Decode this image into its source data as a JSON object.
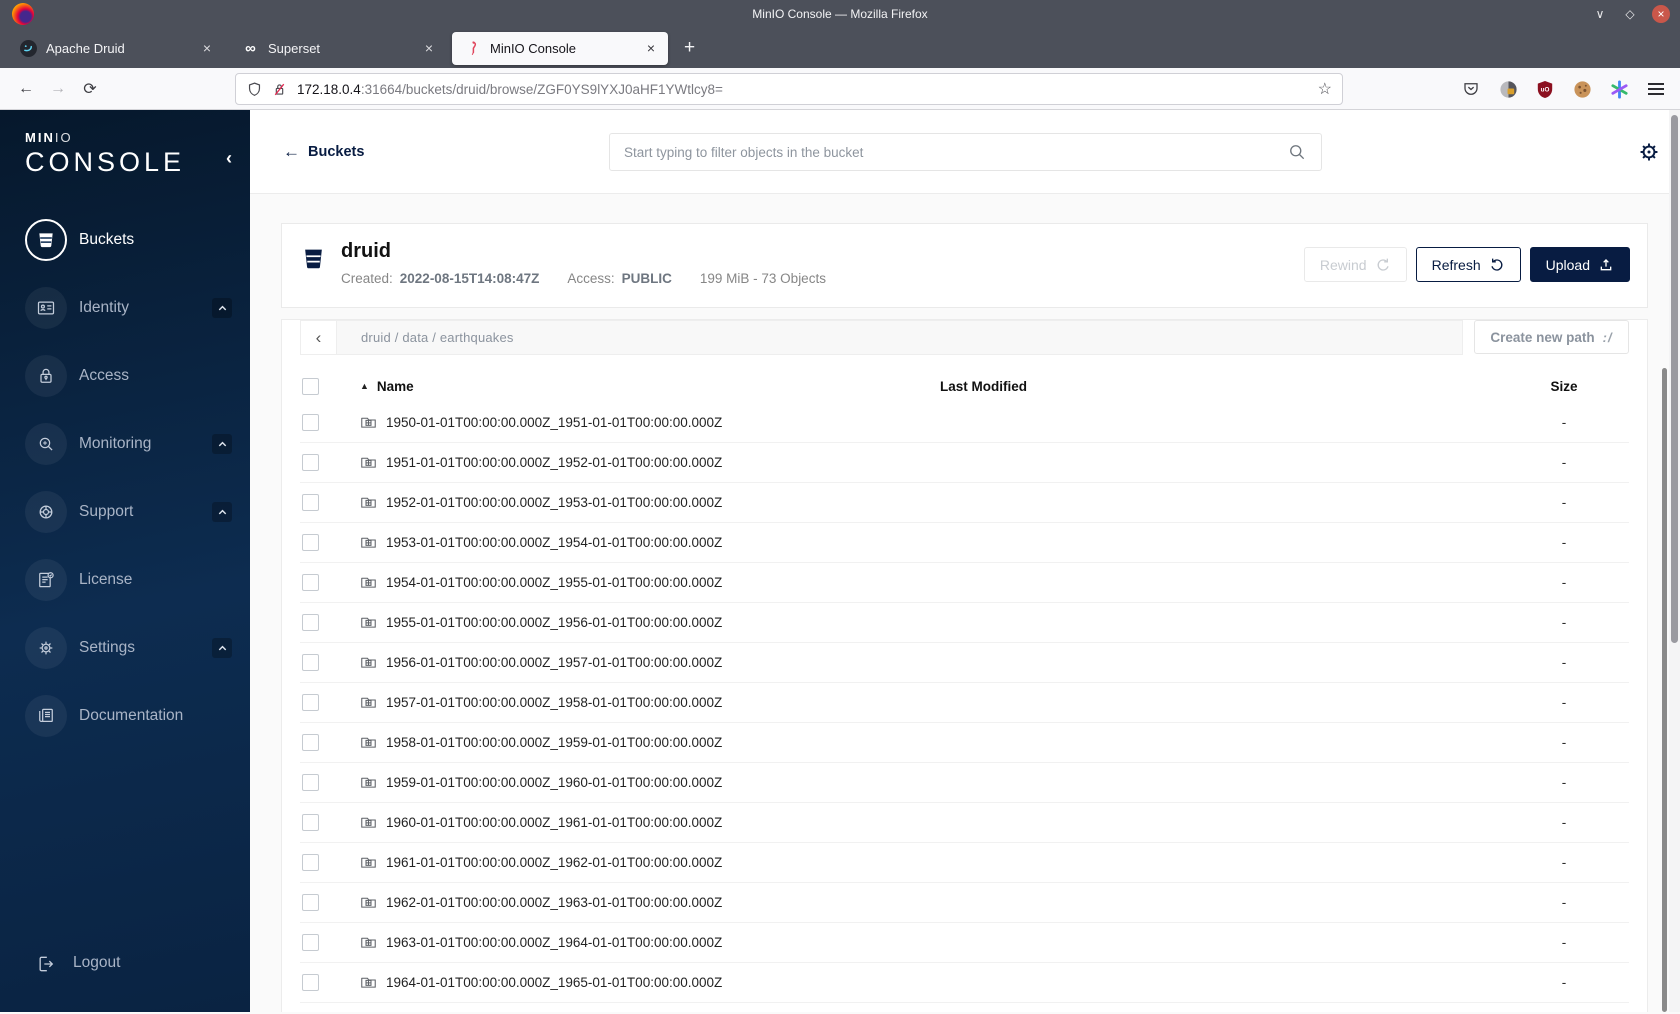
{
  "browser": {
    "window_title": "MinIO Console — Mozilla Firefox",
    "tabs": [
      {
        "title": "Apache Druid",
        "icon": "druid-favicon",
        "active": false
      },
      {
        "title": "Superset",
        "icon": "superset-favicon",
        "active": false
      },
      {
        "title": "MinIO Console",
        "icon": "minio-favicon",
        "active": true
      }
    ],
    "close_glyph": "×",
    "minimize_glyph": "∨",
    "maximize_glyph": "◇",
    "superset_glyph": "∞",
    "back_glyph": "←",
    "forward_glyph": "→",
    "reload_glyph": "⟳",
    "star_glyph": "☆",
    "url_host": "172.18.0.4",
    "url_rest": ":31664/buckets/druid/browse/ZGF0YS9lYXJ0aHF1YWtlcy8="
  },
  "theme": {
    "navy": "#081C42",
    "sidebar_gradient_top": "#06182c",
    "sidebar_gradient_bottom": "#0a2342",
    "page_background": "#fafafa"
  },
  "sidebar": {
    "logo_top_bold": "MIN",
    "logo_top_thin": "IO",
    "logo_main": "CONSOLE",
    "collapse_glyph": "‹",
    "items": [
      {
        "id": "buckets",
        "label": "Buckets",
        "icon": "bucket-icon",
        "active": true,
        "expandable": false
      },
      {
        "id": "identity",
        "label": "Identity",
        "icon": "identity-card-icon",
        "active": false,
        "expandable": true
      },
      {
        "id": "access",
        "label": "Access",
        "icon": "lock-user-icon",
        "active": false,
        "expandable": false
      },
      {
        "id": "monitoring",
        "label": "Monitoring",
        "icon": "monitor-search-icon",
        "active": false,
        "expandable": true
      },
      {
        "id": "support",
        "label": "Support",
        "icon": "lifebuoy-icon",
        "active": false,
        "expandable": true
      },
      {
        "id": "license",
        "label": "License",
        "icon": "license-doc-icon",
        "active": false,
        "expandable": false
      },
      {
        "id": "settings",
        "label": "Settings",
        "icon": "gear-icon",
        "active": false,
        "expandable": true
      },
      {
        "id": "documentation",
        "label": "Documentation",
        "icon": "book-icon",
        "active": false,
        "expandable": false
      }
    ],
    "logout_label": "Logout"
  },
  "header": {
    "back_label": "Buckets",
    "back_glyph": "←",
    "search_placeholder": "Start typing to filter objects in the bucket"
  },
  "bucket": {
    "name": "druid",
    "created_label": "Created:",
    "created_value": "2022-08-15T14:08:47Z",
    "access_label": "Access:",
    "access_value": "PUBLIC",
    "stats": "199 MiB - 73 Objects",
    "rewind_label": "Rewind",
    "refresh_label": "Refresh",
    "upload_label": "Upload"
  },
  "browse": {
    "back_glyph": "‹",
    "path": "druid / data / earthquakes",
    "create_path_label": "Create new path",
    "create_path_glyph": ":/"
  },
  "table": {
    "sort_glyph": "▲",
    "columns": {
      "name": "Name",
      "last_modified": "Last Modified",
      "size": "Size"
    },
    "rows": [
      {
        "name": "1950-01-01T00:00:00.000Z_1951-01-01T00:00:00.000Z",
        "last_modified": "",
        "size": "-"
      },
      {
        "name": "1951-01-01T00:00:00.000Z_1952-01-01T00:00:00.000Z",
        "last_modified": "",
        "size": "-"
      },
      {
        "name": "1952-01-01T00:00:00.000Z_1953-01-01T00:00:00.000Z",
        "last_modified": "",
        "size": "-"
      },
      {
        "name": "1953-01-01T00:00:00.000Z_1954-01-01T00:00:00.000Z",
        "last_modified": "",
        "size": "-"
      },
      {
        "name": "1954-01-01T00:00:00.000Z_1955-01-01T00:00:00.000Z",
        "last_modified": "",
        "size": "-"
      },
      {
        "name": "1955-01-01T00:00:00.000Z_1956-01-01T00:00:00.000Z",
        "last_modified": "",
        "size": "-"
      },
      {
        "name": "1956-01-01T00:00:00.000Z_1957-01-01T00:00:00.000Z",
        "last_modified": "",
        "size": "-"
      },
      {
        "name": "1957-01-01T00:00:00.000Z_1958-01-01T00:00:00.000Z",
        "last_modified": "",
        "size": "-"
      },
      {
        "name": "1958-01-01T00:00:00.000Z_1959-01-01T00:00:00.000Z",
        "last_modified": "",
        "size": "-"
      },
      {
        "name": "1959-01-01T00:00:00.000Z_1960-01-01T00:00:00.000Z",
        "last_modified": "",
        "size": "-"
      },
      {
        "name": "1960-01-01T00:00:00.000Z_1961-01-01T00:00:00.000Z",
        "last_modified": "",
        "size": "-"
      },
      {
        "name": "1961-01-01T00:00:00.000Z_1962-01-01T00:00:00.000Z",
        "last_modified": "",
        "size": "-"
      },
      {
        "name": "1962-01-01T00:00:00.000Z_1963-01-01T00:00:00.000Z",
        "last_modified": "",
        "size": "-"
      },
      {
        "name": "1963-01-01T00:00:00.000Z_1964-01-01T00:00:00.000Z",
        "last_modified": "",
        "size": "-"
      },
      {
        "name": "1964-01-01T00:00:00.000Z_1965-01-01T00:00:00.000Z",
        "last_modified": "",
        "size": "-"
      }
    ]
  }
}
